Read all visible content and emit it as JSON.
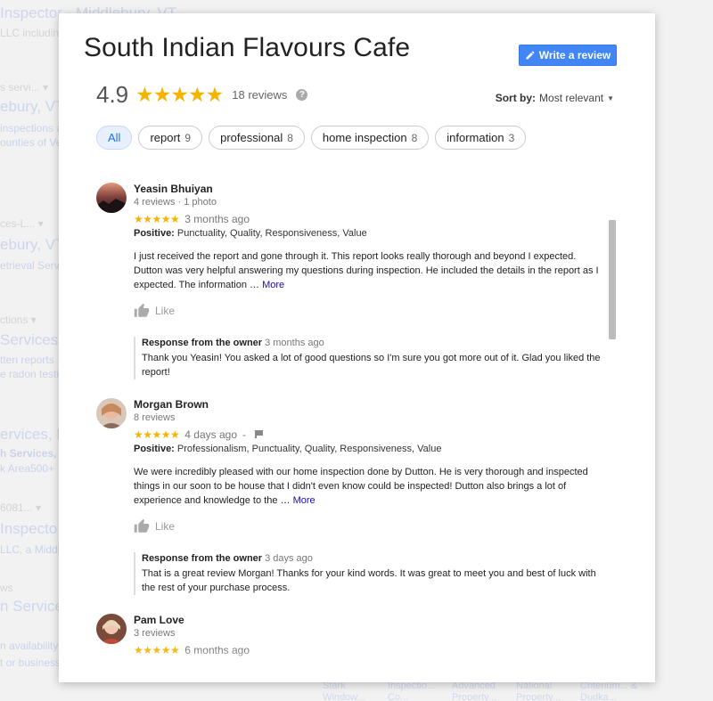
{
  "background": {
    "left_texts": [
      {
        "text": "Inspector - Middlebury, VT",
        "cls": ""
      },
      {
        "text": "LLC including",
        "cls": "small"
      },
      {
        "text": "s servi... ▾",
        "cls": "small"
      },
      {
        "text": "ebury, VT",
        "cls": ""
      },
      {
        "text": "inspections a",
        "cls": "blue-small"
      },
      {
        "text": "ounties of Ve",
        "cls": "blue-small"
      },
      {
        "text": "ces-L... ▾",
        "cls": "small"
      },
      {
        "text": "ebury, VT",
        "cls": ""
      },
      {
        "text": "etrieval Servi",
        "cls": "blue-small"
      },
      {
        "text": "ctions ▾",
        "cls": "small"
      },
      {
        "text": "Services,",
        "cls": ""
      },
      {
        "text": "tten reports",
        "cls": "blue-small"
      },
      {
        "text": "e radon testi",
        "cls": "blue-small"
      },
      {
        "text": "ervices, L",
        "cls": ""
      },
      {
        "text": "h Services, L",
        "cls": "blue-small bold"
      },
      {
        "text": "k Area500+",
        "cls": "blue-small"
      },
      {
        "text": "6081... ▾",
        "cls": "small"
      },
      {
        "text": "Inspecto",
        "cls": ""
      },
      {
        "text": "LLC, a Middl",
        "cls": "blue-small"
      },
      {
        "text": "ws",
        "cls": "small"
      },
      {
        "text": "n Services",
        "cls": ""
      },
      {
        "text": "n availability",
        "cls": "blue-small"
      },
      {
        "text": "t or business",
        "cls": "blue-small"
      }
    ],
    "bottom_items": [
      "Stark Window...",
      "Inspectio... Co...",
      "Advanced Property...",
      "National Property...",
      "Criterium... & Dudka..."
    ]
  },
  "dialog": {
    "title": "South Indian Flavours Cafe",
    "write_review_label": "Write a review",
    "rating": "4.9",
    "stars": "★★★★★",
    "review_count": "18 reviews",
    "help_icon": "?",
    "sort_label": "Sort by:",
    "sort_value": "Most relevant",
    "chips": [
      {
        "label": "All",
        "count": ""
      },
      {
        "label": "report",
        "count": "9"
      },
      {
        "label": "professional",
        "count": "8"
      },
      {
        "label": "home inspection",
        "count": "8"
      },
      {
        "label": "information",
        "count": "3"
      }
    ],
    "reviews": [
      {
        "name": "Yeasin Bhuiyan",
        "meta": "4 reviews · 1 photo",
        "stars": "★★★★★",
        "time": "3 months ago",
        "positive_label": "Positive:",
        "positive": "Punctuality, Quality, Responsiveness, Value",
        "text": "I just received the report and gone through it. This report looks really thorough and beyond I expected. Dutton was very helpful answering my questions during inspection. He included the details in the report as I expected. The information …",
        "more": "More",
        "like": "Like",
        "response_label": "Response from the owner",
        "response_time": "3 months ago",
        "response_text": "Thank you Yeasin! You asked a lot of good questions so I'm sure you got more out of it. Glad you liked the report!"
      },
      {
        "name": "Morgan Brown",
        "meta": "8 reviews",
        "stars": "★★★★★",
        "time": "4 days ago",
        "time_suffix": "-",
        "positive_label": "Positive:",
        "positive": "Professionalism, Punctuality, Quality, Responsiveness, Value",
        "text": "We were incredibly pleased with our home inspection done by Dutton. He is very thorough and inspected things in our soon to be house that I didn't even know could be inspected! Dutton also brings a lot of experience and knowledge to the …",
        "more": "More",
        "like": "Like",
        "response_label": "Response from the owner",
        "response_time": "3 days ago",
        "response_text": "That is a great review Morgan! Thanks for your kind words. It was great to meet you and best of luck with the rest of your purchase process."
      },
      {
        "name": "Pam Love",
        "meta": "3 reviews",
        "stars": "★★★★★",
        "time": "6 months ago"
      }
    ]
  },
  "colors": {
    "accent": "#4285f4",
    "star": "#f4b400",
    "link": "#1a0dab"
  }
}
